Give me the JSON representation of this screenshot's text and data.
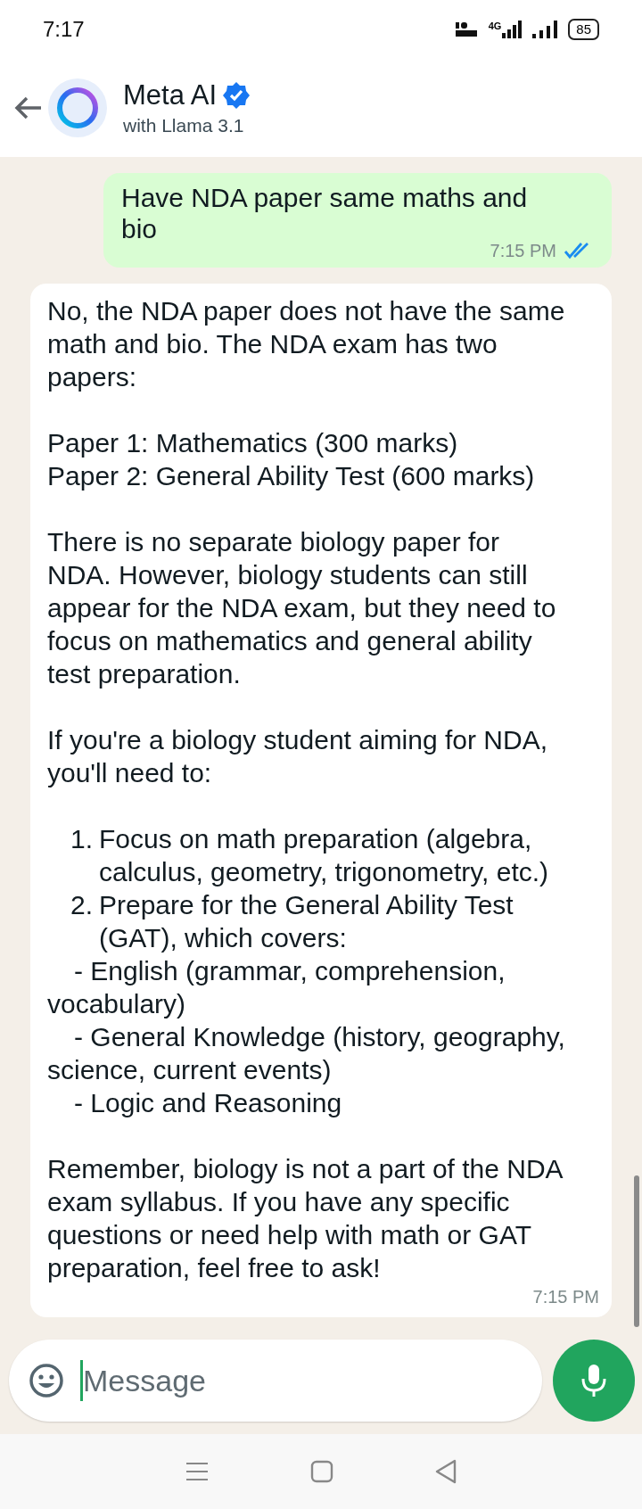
{
  "status_bar": {
    "time": "7:17",
    "network_label": "4G",
    "battery": "85"
  },
  "header": {
    "title": "Meta AI",
    "verified": true,
    "subtitle": "with Llama 3.1"
  },
  "messages": [
    {
      "kind": "sent",
      "text": "Have NDA paper same maths and\nbio",
      "time": "7:15 PM",
      "read": true
    },
    {
      "kind": "received",
      "time": "7:15 PM",
      "blocks": [
        {
          "kind": "para",
          "text": "No, the NDA paper does not have the same\nmath and bio. The NDA exam has two\npapers:"
        },
        {
          "kind": "para",
          "text": "Paper 1: Mathematics (300 marks)\nPaper 2: General Ability Test (600 marks)"
        },
        {
          "kind": "para",
          "text": "There is no separate biology paper for\nNDA. However, biology students can still\nappear for the NDA exam, but they need to\nfocus on mathematics and general ability\ntest preparation."
        },
        {
          "kind": "para",
          "text": "If you're a biology student aiming for NDA,\nyou'll need to:"
        },
        {
          "kind": "numbered",
          "number": "1.",
          "text": "Focus on math preparation (algebra,\ncalculus, geometry, trigonometry, etc.)"
        },
        {
          "kind": "numbered",
          "number": "2.",
          "text": "Prepare for the General Ability Test\n(GAT), which covers:"
        },
        {
          "kind": "dash",
          "text": "- English (grammar, comprehension,\nvocabulary)"
        },
        {
          "kind": "dash",
          "text": "- General Knowledge (history, geography,\nscience, current events)"
        },
        {
          "kind": "dash",
          "text": "- Logic and Reasoning"
        },
        {
          "kind": "para",
          "text": "Remember, biology is not a part of the NDA\nexam syllabus. If you have any specific\nquestions or need help with math or GAT\npreparation, feel free to ask!"
        }
      ]
    }
  ],
  "composer": {
    "placeholder": "Message"
  }
}
